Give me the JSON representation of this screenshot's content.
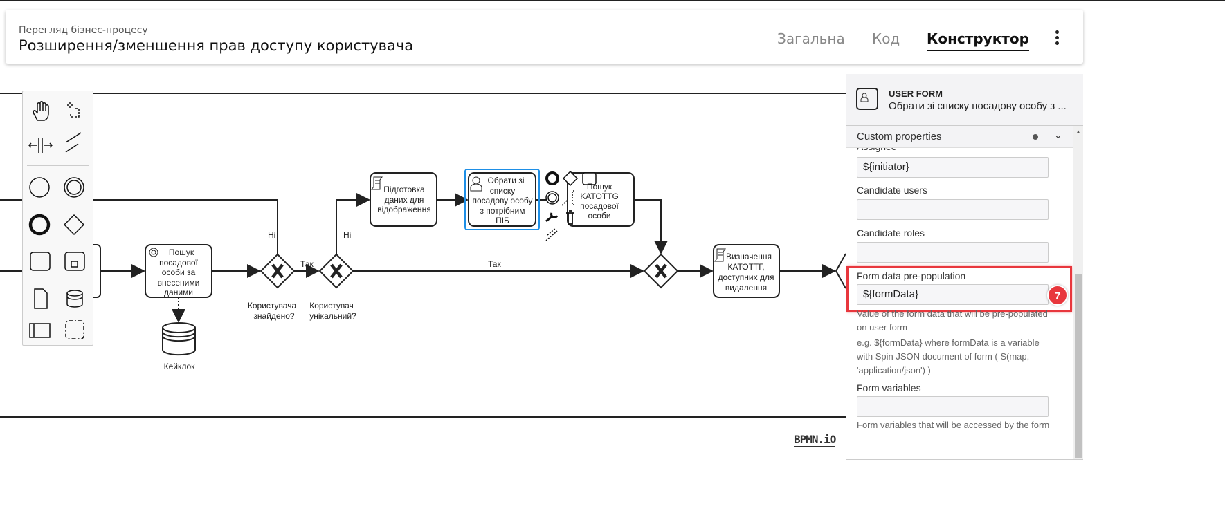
{
  "header": {
    "subtitle": "Перегляд бізнес-процесу",
    "title": "Розширення/зменшення прав доступу користувача",
    "tabs": [
      {
        "label": "Загальна",
        "active": false
      },
      {
        "label": "Код",
        "active": false
      },
      {
        "label": "Конструктор",
        "active": true
      }
    ],
    "menu_icon": "kebab-menu-icon"
  },
  "palette": {
    "tools": [
      "hand-tool-icon",
      "lasso-tool-icon",
      "space-tool-icon",
      "connect-tool-icon"
    ],
    "shapes": [
      "start-event-icon",
      "intermediate-event-icon",
      "end-event-icon",
      "gateway-icon",
      "task-icon",
      "subprocess-icon",
      "data-object-icon",
      "data-store-icon",
      "participant-icon",
      "group-icon"
    ]
  },
  "diagram": {
    "tasks": {
      "search": [
        "Пошук",
        "посадової",
        "особи за",
        "внесеними",
        "даними"
      ],
      "prepare": [
        "Підготовка",
        "даних для",
        "відображення"
      ],
      "select": [
        "Обрати зі",
        "списку",
        "посадову особу",
        "з потрібним",
        "ПІБ"
      ],
      "katottg": [
        "Пошук",
        "KATOTTG",
        "посадової",
        "особи"
      ],
      "define": [
        "Визначення",
        "КАТОТТГ,",
        "доступних для",
        "видалення"
      ]
    },
    "datastore": "Кейклок",
    "gateways": {
      "found": [
        "Користувача",
        "знайдено?"
      ],
      "unique": [
        "Користувач",
        "унікальний?"
      ]
    },
    "flows": {
      "no1": "Ні",
      "yes1": "Так",
      "no2": "Ні",
      "yes2": "Так"
    }
  },
  "panel": {
    "element_type": "USER FORM",
    "element_name": "Обрати зі списку посадову особу з ...",
    "group": "Custom properties",
    "fields": {
      "assignee": {
        "label": "Assignee",
        "value": "${initiator}"
      },
      "candidate_users": {
        "label": "Candidate users",
        "value": ""
      },
      "candidate_roles": {
        "label": "Candidate roles",
        "value": ""
      },
      "form_data": {
        "label": "Form data pre-population",
        "value": "${formData}",
        "desc1": "Value of the form data that will be pre-populated on user form",
        "desc2": "e.g. ${formData} where formData is a variable with Spin JSON document of form ( S(map, 'application/json') )"
      },
      "form_variables": {
        "label": "Form variables",
        "value": "",
        "desc": "Form variables that will be accessed by the form"
      }
    }
  },
  "badge": "7",
  "logo": "BPMN.iO",
  "colors": {
    "selection": "#1e8fe6",
    "highlight": "#e8373d"
  }
}
